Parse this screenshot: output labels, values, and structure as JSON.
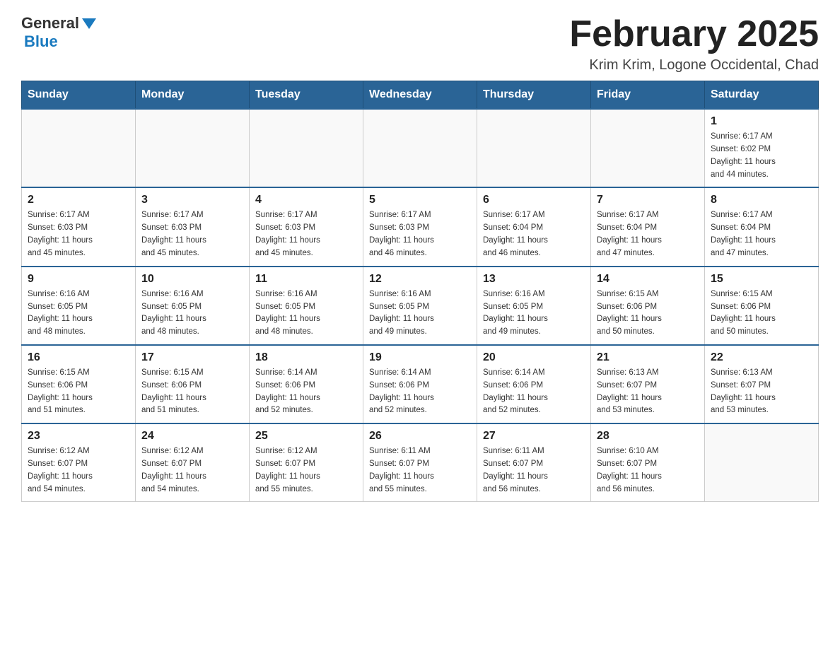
{
  "header": {
    "logo_general": "General",
    "logo_blue": "Blue",
    "title": "February 2025",
    "subtitle": "Krim Krim, Logone Occidental, Chad"
  },
  "weekdays": [
    "Sunday",
    "Monday",
    "Tuesday",
    "Wednesday",
    "Thursday",
    "Friday",
    "Saturday"
  ],
  "weeks": [
    [
      {
        "day": "",
        "info": ""
      },
      {
        "day": "",
        "info": ""
      },
      {
        "day": "",
        "info": ""
      },
      {
        "day": "",
        "info": ""
      },
      {
        "day": "",
        "info": ""
      },
      {
        "day": "",
        "info": ""
      },
      {
        "day": "1",
        "info": "Sunrise: 6:17 AM\nSunset: 6:02 PM\nDaylight: 11 hours\nand 44 minutes."
      }
    ],
    [
      {
        "day": "2",
        "info": "Sunrise: 6:17 AM\nSunset: 6:03 PM\nDaylight: 11 hours\nand 45 minutes."
      },
      {
        "day": "3",
        "info": "Sunrise: 6:17 AM\nSunset: 6:03 PM\nDaylight: 11 hours\nand 45 minutes."
      },
      {
        "day": "4",
        "info": "Sunrise: 6:17 AM\nSunset: 6:03 PM\nDaylight: 11 hours\nand 45 minutes."
      },
      {
        "day": "5",
        "info": "Sunrise: 6:17 AM\nSunset: 6:03 PM\nDaylight: 11 hours\nand 46 minutes."
      },
      {
        "day": "6",
        "info": "Sunrise: 6:17 AM\nSunset: 6:04 PM\nDaylight: 11 hours\nand 46 minutes."
      },
      {
        "day": "7",
        "info": "Sunrise: 6:17 AM\nSunset: 6:04 PM\nDaylight: 11 hours\nand 47 minutes."
      },
      {
        "day": "8",
        "info": "Sunrise: 6:17 AM\nSunset: 6:04 PM\nDaylight: 11 hours\nand 47 minutes."
      }
    ],
    [
      {
        "day": "9",
        "info": "Sunrise: 6:16 AM\nSunset: 6:05 PM\nDaylight: 11 hours\nand 48 minutes."
      },
      {
        "day": "10",
        "info": "Sunrise: 6:16 AM\nSunset: 6:05 PM\nDaylight: 11 hours\nand 48 minutes."
      },
      {
        "day": "11",
        "info": "Sunrise: 6:16 AM\nSunset: 6:05 PM\nDaylight: 11 hours\nand 48 minutes."
      },
      {
        "day": "12",
        "info": "Sunrise: 6:16 AM\nSunset: 6:05 PM\nDaylight: 11 hours\nand 49 minutes."
      },
      {
        "day": "13",
        "info": "Sunrise: 6:16 AM\nSunset: 6:05 PM\nDaylight: 11 hours\nand 49 minutes."
      },
      {
        "day": "14",
        "info": "Sunrise: 6:15 AM\nSunset: 6:06 PM\nDaylight: 11 hours\nand 50 minutes."
      },
      {
        "day": "15",
        "info": "Sunrise: 6:15 AM\nSunset: 6:06 PM\nDaylight: 11 hours\nand 50 minutes."
      }
    ],
    [
      {
        "day": "16",
        "info": "Sunrise: 6:15 AM\nSunset: 6:06 PM\nDaylight: 11 hours\nand 51 minutes."
      },
      {
        "day": "17",
        "info": "Sunrise: 6:15 AM\nSunset: 6:06 PM\nDaylight: 11 hours\nand 51 minutes."
      },
      {
        "day": "18",
        "info": "Sunrise: 6:14 AM\nSunset: 6:06 PM\nDaylight: 11 hours\nand 52 minutes."
      },
      {
        "day": "19",
        "info": "Sunrise: 6:14 AM\nSunset: 6:06 PM\nDaylight: 11 hours\nand 52 minutes."
      },
      {
        "day": "20",
        "info": "Sunrise: 6:14 AM\nSunset: 6:06 PM\nDaylight: 11 hours\nand 52 minutes."
      },
      {
        "day": "21",
        "info": "Sunrise: 6:13 AM\nSunset: 6:07 PM\nDaylight: 11 hours\nand 53 minutes."
      },
      {
        "day": "22",
        "info": "Sunrise: 6:13 AM\nSunset: 6:07 PM\nDaylight: 11 hours\nand 53 minutes."
      }
    ],
    [
      {
        "day": "23",
        "info": "Sunrise: 6:12 AM\nSunset: 6:07 PM\nDaylight: 11 hours\nand 54 minutes."
      },
      {
        "day": "24",
        "info": "Sunrise: 6:12 AM\nSunset: 6:07 PM\nDaylight: 11 hours\nand 54 minutes."
      },
      {
        "day": "25",
        "info": "Sunrise: 6:12 AM\nSunset: 6:07 PM\nDaylight: 11 hours\nand 55 minutes."
      },
      {
        "day": "26",
        "info": "Sunrise: 6:11 AM\nSunset: 6:07 PM\nDaylight: 11 hours\nand 55 minutes."
      },
      {
        "day": "27",
        "info": "Sunrise: 6:11 AM\nSunset: 6:07 PM\nDaylight: 11 hours\nand 56 minutes."
      },
      {
        "day": "28",
        "info": "Sunrise: 6:10 AM\nSunset: 6:07 PM\nDaylight: 11 hours\nand 56 minutes."
      },
      {
        "day": "",
        "info": ""
      }
    ]
  ]
}
